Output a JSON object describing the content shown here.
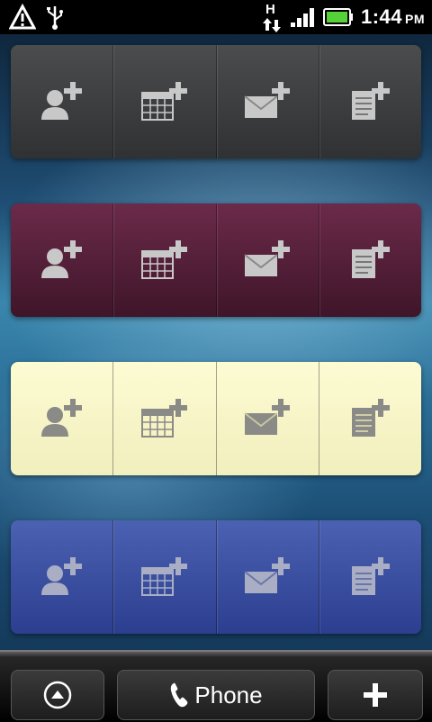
{
  "status_bar": {
    "time": "1:44",
    "ampm": "PM",
    "network_type": "H",
    "icons": [
      "warning-icon",
      "usb-icon",
      "network-data-icon",
      "signal-icon",
      "battery-icon"
    ]
  },
  "widgets": [
    {
      "name": "gray",
      "color": "#3d3f41",
      "items": [
        "add-contact-icon",
        "add-event-icon",
        "add-message-icon",
        "add-note-icon"
      ]
    },
    {
      "name": "plum",
      "color": "#5a2240",
      "items": [
        "add-contact-icon",
        "add-event-icon",
        "add-message-icon",
        "add-note-icon"
      ]
    },
    {
      "name": "cream",
      "color": "#f9f7c9",
      "items": [
        "add-contact-icon",
        "add-event-icon",
        "add-message-icon",
        "add-note-icon"
      ]
    },
    {
      "name": "blue",
      "color": "#3b50a4",
      "items": [
        "add-contact-icon",
        "add-event-icon",
        "add-message-icon",
        "add-note-icon"
      ]
    }
  ],
  "dock": {
    "phone_label": "Phone",
    "icons": [
      "launcher-up-icon",
      "phone-icon",
      "plus-icon"
    ]
  }
}
